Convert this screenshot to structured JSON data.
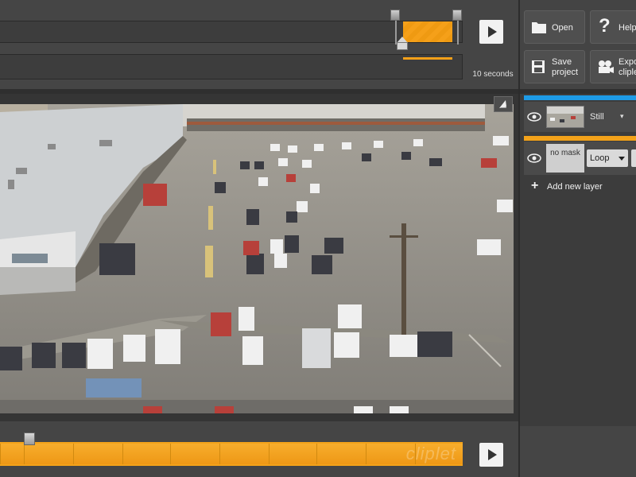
{
  "timeline_top": {
    "duration_label": "10 seconds"
  },
  "toolbar": {
    "open_label": "Open",
    "help_label": "Help",
    "save_label": "Save project",
    "export_label": "Export cliplet"
  },
  "layers": {
    "still": {
      "mode_label": "Still"
    },
    "loop": {
      "mask_label": "no mask",
      "mode_label": "Loop"
    },
    "add_layer_label": "Add new layer"
  },
  "timeline_bottom": {
    "watermark_text": "cliplet"
  },
  "colors": {
    "accent_orange": "#f3a21a",
    "layer_blue": "#1e9be6",
    "panel_dark": "#3c3c3c"
  },
  "icons": {
    "play": "play-icon",
    "folder": "folder-icon",
    "help": "question-icon",
    "save": "floppy-disk-icon",
    "export": "video-camera-icon",
    "eye": "eye-icon",
    "add": "plus-icon",
    "expand": "expand-icon"
  }
}
